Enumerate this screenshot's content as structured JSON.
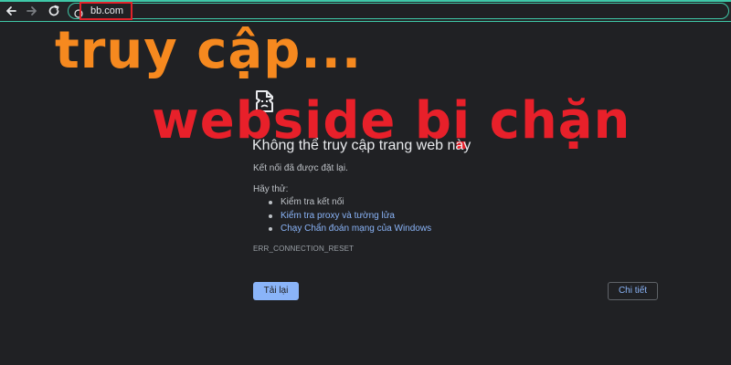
{
  "browser": {
    "url": "bb.com",
    "nav_icons": {
      "back": "arrow-left-icon",
      "forward": "arrow-right-icon",
      "reload": "reload-icon",
      "site_info": "site-info-icon"
    }
  },
  "overlay": {
    "line1": "truy cập...",
    "line2": "webside bị chặn",
    "line1_color": "#f6891f",
    "line2_color": "#e8202a"
  },
  "error_page": {
    "icon": "broken-document-icon",
    "title": "Không thể truy cập trang web này",
    "subtitle": "Kết nối đã được đặt lại.",
    "try_label": "Hãy thử:",
    "suggestions": [
      {
        "text": "Kiểm tra kết nối",
        "is_link": false
      },
      {
        "text": "Kiểm tra proxy và tường lửa",
        "is_link": true
      },
      {
        "text": "Chạy Chẩn đoán mạng của Windows",
        "is_link": true
      }
    ],
    "error_code": "ERR_CONNECTION_RESET",
    "reload_label": "Tải lại",
    "details_label": "Chi tiết"
  },
  "colors": {
    "background": "#202124",
    "accent": "#3fc8a8",
    "link": "#8ab4f8",
    "highlight_box": "#e0232a"
  }
}
